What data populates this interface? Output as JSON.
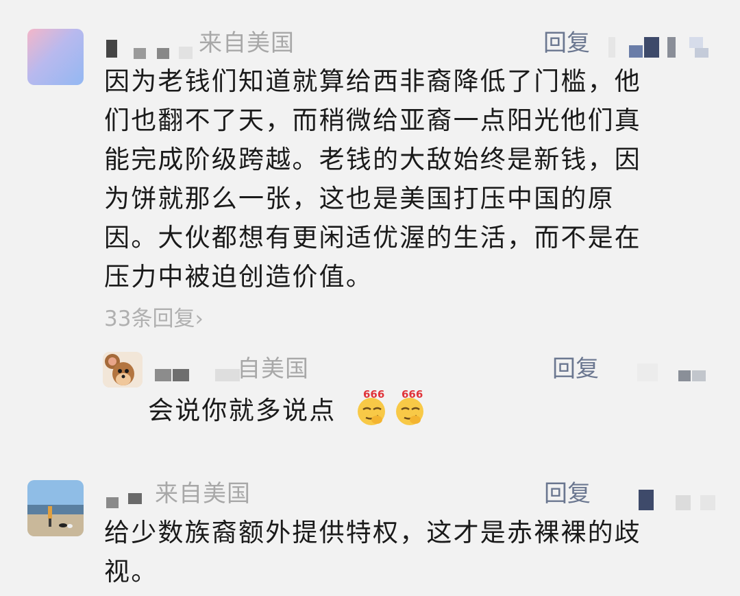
{
  "comments": [
    {
      "location": "来自美国",
      "reply_label": "回复",
      "text_lines": [
        "因为老钱们知道就算给西非裔降低了门槛，他",
        "们也翻不了天，而稍微给亚裔一点阳光他们真",
        "能完成阶级跨越。老钱的大敌始终是新钱，因",
        "为饼就那么一张，这也是美国打压中国的原",
        "因。大伙都想有更闲适优渥的生活，而不是在",
        "压力中被迫创造价值。"
      ],
      "reply_count": "33条回复",
      "reply_count_chevron": "›",
      "sub_reply": {
        "location": "自美国",
        "reply_label": "回复",
        "text": "会说你就多说点",
        "emoji_badge": "666",
        "emoji_icon": "smirk-666-emoji"
      }
    },
    {
      "location": "来自美国",
      "reply_label": "回复",
      "text_lines": [
        "给少数族裔额外提供特权，这才是赤裸裸的歧",
        "视。"
      ]
    }
  ],
  "colors": {
    "background": "#f2f2f2",
    "body_text": "#1a1a1a",
    "meta_text": "#a8a8a8",
    "reply_link": "#6b7790",
    "emoji_badge": "#e0353b"
  }
}
